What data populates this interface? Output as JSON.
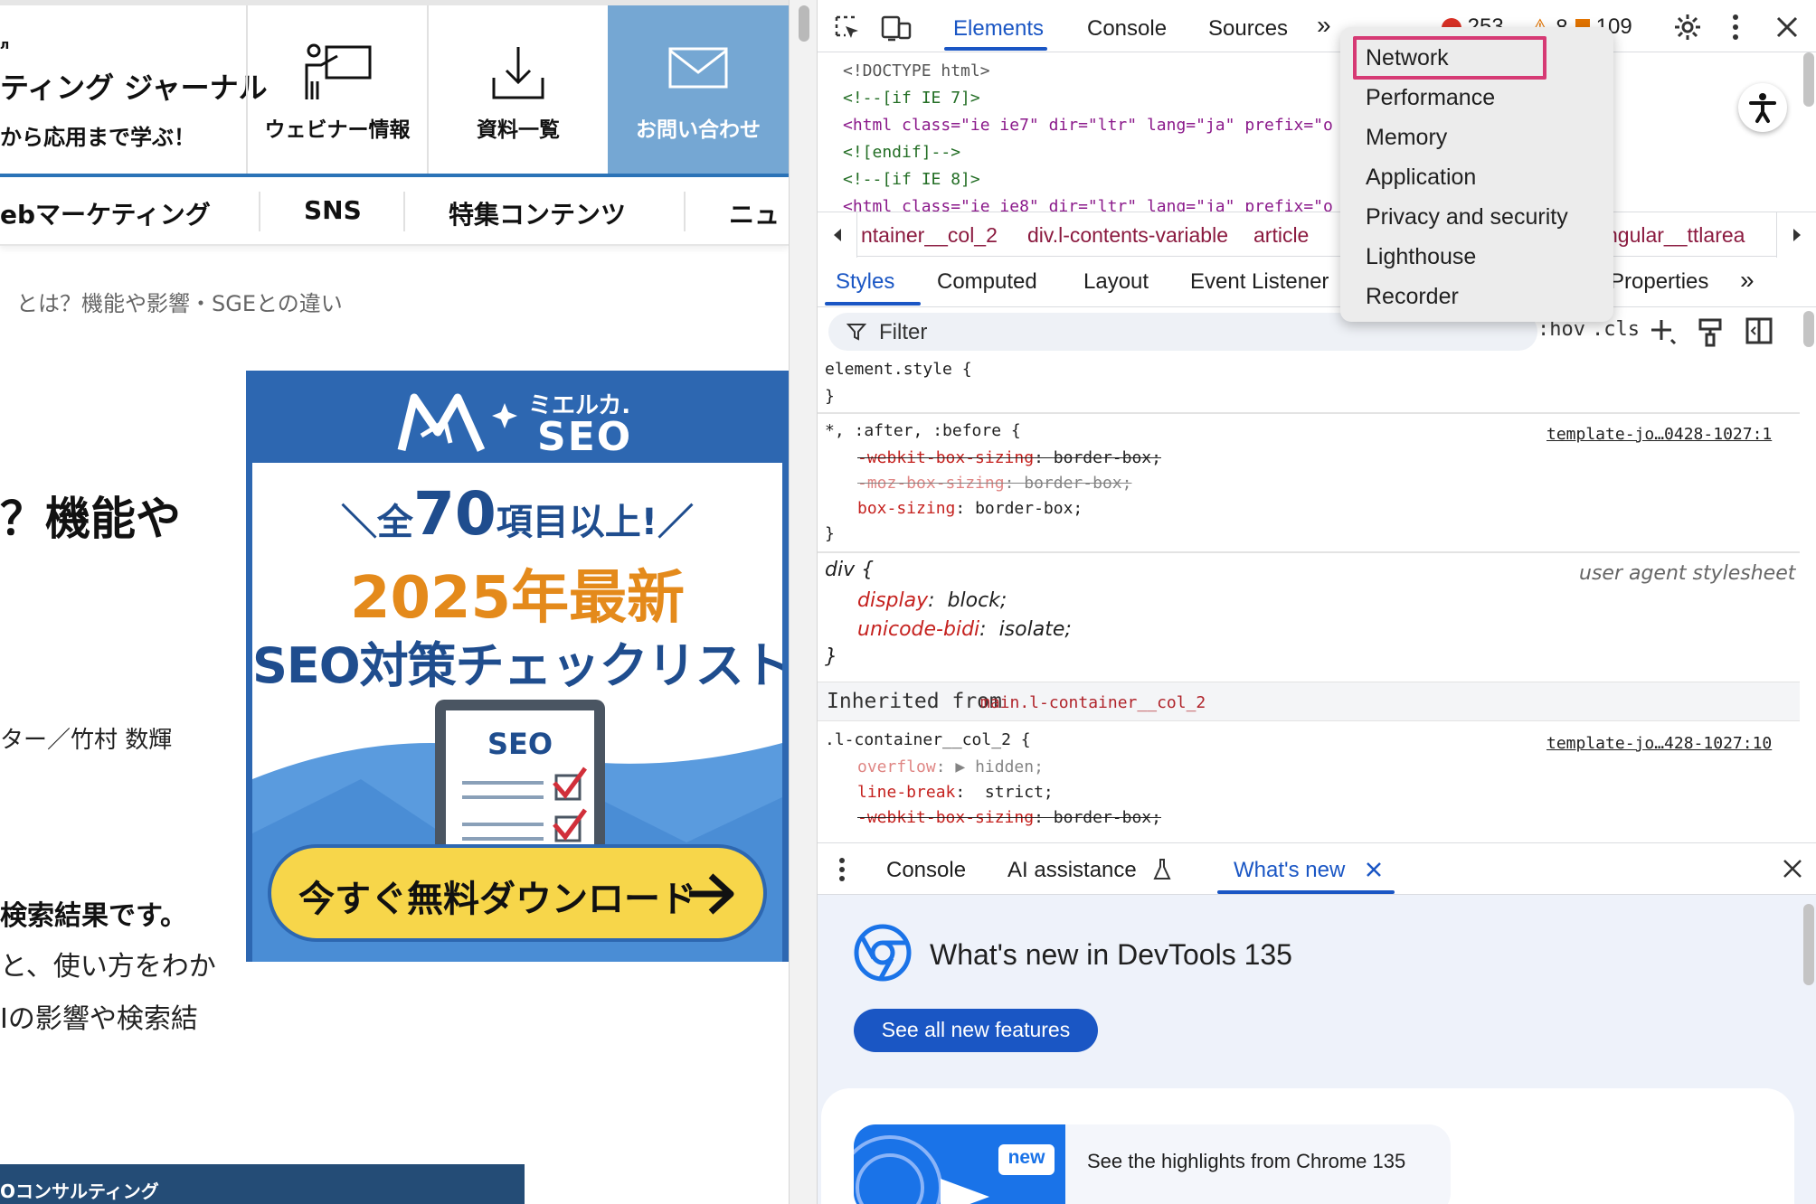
{
  "site": {
    "brand": {
      "line0": "л",
      "line1": "ティング ジャーナル",
      "line2": "から応用まで学ぶ！"
    },
    "header_nav": {
      "webinar": "ウェビナー情報",
      "docs": "資料一覧",
      "contact": "お問い合わせ"
    },
    "category_nav": [
      "ebマーケティング",
      "SNS",
      "特集コンテンツ",
      "ニュ"
    ],
    "breadcrumb": "とは？機能や影響・SGEとの違い",
    "article_title_fragment": "？機能や",
    "author": "ター／竹村 数輝",
    "lead": [
      "検索結果です。",
      "と、使い方をわか",
      "Iの影響や検索結"
    ],
    "bottom_banner": "Oコンサルティング",
    "ad": {
      "brand_small": "ミエルカ.",
      "brand_big": "SEO",
      "headline_pre": "＼全",
      "headline_num": "70",
      "headline_post": "項目以上!／",
      "year_line": "2025年最新",
      "title": "SEO対策チェックリスト",
      "clipboard_label": "SEO",
      "cta": "今すぐ無料ダウンロード"
    }
  },
  "devtools": {
    "tabs": [
      "Elements",
      "Console",
      "Sources"
    ],
    "active_tab": "Elements",
    "more_tabs_glyph": "»",
    "errors": "253",
    "warnings": "8",
    "issues": "109",
    "html_lines": [
      "<!DOCTYPE html>",
      "<!--[if IE 7]>",
      "<html class=\"ie ie7\" dir=\"ltr\" lang=\"ja\" prefix=\"o",
      "<![endif]-->",
      "<!--[if IE 8]>",
      "<html class=\"ie ie8\" dir=\"ltr\" lang=\"ja\" prefix=\"o"
    ],
    "breadcrumbs": [
      "ntainer__col_2",
      "div.l-contents-variable",
      "article",
      "ngular__ttlarea"
    ],
    "sub_tabs": [
      "Styles",
      "Computed",
      "Layout",
      "Event Listener",
      "Properties"
    ],
    "active_sub_tab": "Styles",
    "filter_placeholder": "Filter",
    "filter_hov": ":hov",
    "filter_cls": ".cls",
    "rules": {
      "element_style": "element.style {",
      "close": "}",
      "universal_selector": "*, :after, :before {",
      "universal_source": "template-jo…0428-1027:1",
      "webkit_box_sizing_prop": "-webkit-box-sizing",
      "border_box": "border-box;",
      "moz_box_sizing_prop": "-moz-box-sizing",
      "box_sizing_prop": "box-sizing",
      "div_selector": "div {",
      "ua_stylesheet": "user agent stylesheet",
      "display_prop": "display",
      "display_val": "block;",
      "unicode_prop": "unicode-bidi",
      "unicode_val": "isolate;",
      "inherited_label": "Inherited from",
      "inherited_from": "main.l-container__col_2",
      "container_selector": ".l-container__col_2 {",
      "container_source": "template-jo…428-1027:10",
      "overflow_prop": "overflow",
      "overflow_val": "hidden;",
      "line_break_prop": "line-break",
      "line_break_val": "strict;"
    },
    "drawer_tabs": [
      "Console",
      "AI assistance",
      "What's new"
    ],
    "active_drawer_tab": "What's new",
    "whats_new": {
      "title": "What's new in DevTools 135",
      "button": "See all new features",
      "new_badge": "new",
      "highlight": "See the highlights from Chrome 135"
    },
    "overflow_menu": [
      "Network",
      "Performance",
      "Memory",
      "Application",
      "Privacy and security",
      "Lighthouse",
      "Recorder"
    ],
    "highlighted_menu_item": "Network",
    "colors": {
      "accent": "#1a56c4",
      "highlight_border": "#d63a74",
      "error": "#d93025",
      "warning": "#e37400"
    }
  }
}
